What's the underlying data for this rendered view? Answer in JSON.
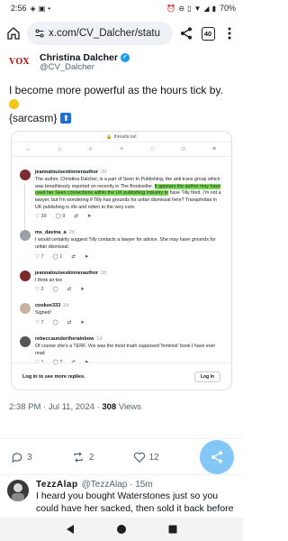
{
  "status_bar": {
    "time": "2:56",
    "battery": "70%"
  },
  "browser": {
    "url": "x.com/CV_Dalcher/statu",
    "tab_count": "40"
  },
  "tweet": {
    "logo_text": "VOX",
    "author_name": "Christina Dalcher",
    "author_handle": "@CV_Dalcher",
    "text": "I become more powerful as the hours tick by.",
    "tag_text": "{sarcasm}",
    "meta_time": "2:38 PM · Jul 11, 2024 ·",
    "views_count": "308",
    "views_label": "Views"
  },
  "embed": {
    "url": "threads.net",
    "posts": [
      {
        "user": "jeannalouiseskinnerauthor",
        "time": "2d",
        "body_before": "The author, Christina Dalcher, is a part of Seen In Publishing, the anti trans group which was breathlessly reported on recently in The Bookseller. ",
        "body_highlight": "It appears the author may have used her Seen connections within the UK publishing industry to",
        "body_after": " have Tilly fired. I'm not a lawyer, but I'm wondering if Tilly has grounds for unfair dismissal here? Transphobia in UK publishing is rife and rotten to the very core.",
        "likes": "39",
        "replies": "9",
        "reposts": "",
        "shares": ""
      },
      {
        "user": "ms_davina_a",
        "time": "2d",
        "body_before": "I would certainly suggest Tilly contacts a lawyer for advice. She may have grounds for unfair dismissal.",
        "body_highlight": "",
        "body_after": "",
        "likes": "7",
        "replies": "1",
        "reposts": "",
        "shares": ""
      },
      {
        "user": "jeannalouiseskinnerauthor",
        "time": "2d",
        "body_before": "I think so too",
        "body_highlight": "",
        "body_after": "",
        "likes": "2",
        "replies": "",
        "reposts": "",
        "shares": ""
      },
      {
        "user": "cookee333",
        "time": "2d",
        "body_before": "Signed!",
        "body_highlight": "",
        "body_after": "",
        "likes": "7",
        "replies": "",
        "reposts": "",
        "shares": ""
      },
      {
        "user": "rebeccaundertherainbow",
        "time": "1d",
        "body_before": "Of course she's a TERF. Vox was the most trash supposed 'feminist' book I have ever read",
        "body_highlight": "",
        "body_after": "",
        "likes": "1",
        "replies": "2",
        "reposts": "",
        "shares": ""
      }
    ],
    "login_text": "Log in to see more replies.",
    "login_button": "Log in"
  },
  "actions": {
    "replies": "3",
    "reposts": "2",
    "likes": "12"
  },
  "reply": {
    "name": "TezzAlap",
    "handle": "@TezzAlap · 15m",
    "text": "I heard you bought Waterstones just so you could have her sacked, then sold it back before anyone"
  },
  "colors": {
    "accent": "#1d9bf0",
    "highlight": "#7ed957"
  }
}
